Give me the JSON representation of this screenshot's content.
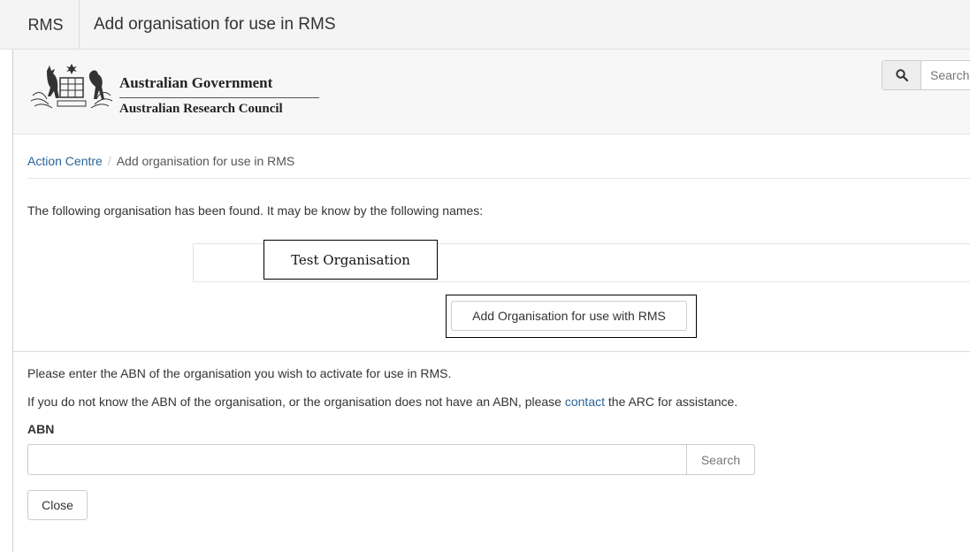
{
  "topbar": {
    "app_name": "RMS",
    "page_title": "Add organisation for use in RMS"
  },
  "header": {
    "logo": {
      "line1": "Australian Government",
      "line2": "Australian Research Council"
    },
    "search": {
      "placeholder": "Search",
      "icon": "search-icon"
    }
  },
  "breadcrumb": {
    "home": "Action Centre",
    "separator": "/",
    "current": "Add organisation for use in RMS"
  },
  "found": {
    "message": "The following organisation has been found. It may be know by the following names:",
    "names": [
      "Test Organisation"
    ],
    "add_button": "Add Organisation for use with RMS"
  },
  "abn_section": {
    "intro": "Please enter the ABN of the organisation you wish to activate for use in RMS.",
    "help_prefix": "If you do not know the ABN of the organisation, or the organisation does not have an ABN, please ",
    "help_link": "contact",
    "help_suffix": " the ARC for assistance.",
    "label": "ABN",
    "input_value": "",
    "search_button": "Search",
    "close_button": "Close"
  },
  "colors": {
    "link": "#2a6496",
    "topbar_bg": "#f4f4f4",
    "header_bg": "#f7f7f7"
  }
}
